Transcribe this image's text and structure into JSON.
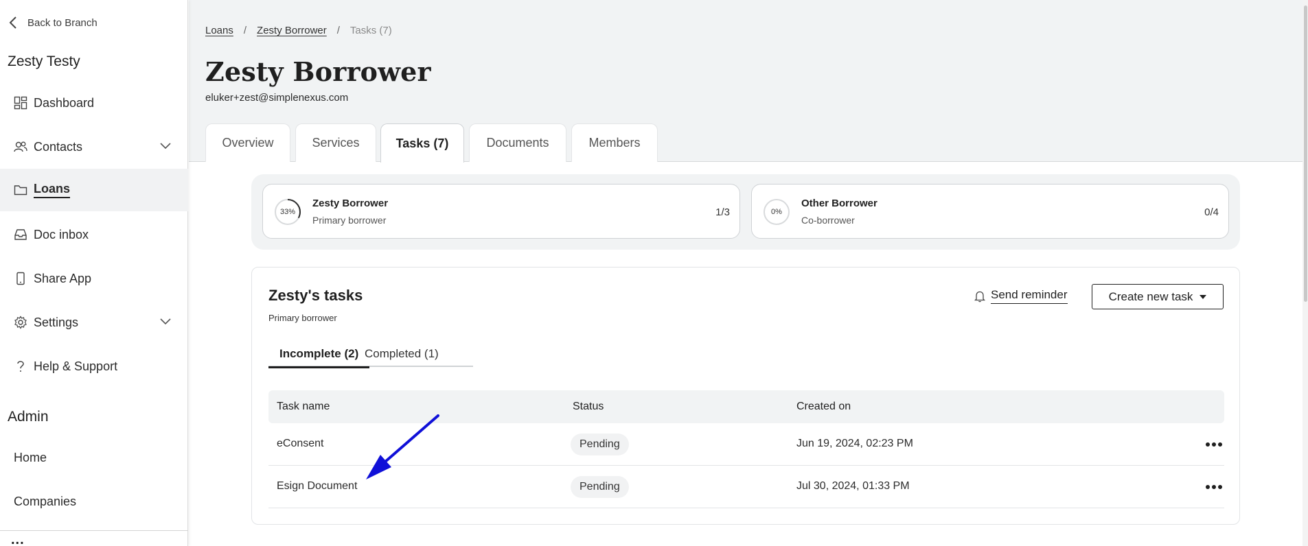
{
  "sidebar": {
    "back_label": "Back to Branch",
    "branch_name": "Zesty Testy",
    "items": [
      {
        "label": "Dashboard",
        "icon": "dashboard-icon"
      },
      {
        "label": "Contacts",
        "icon": "contacts-icon"
      },
      {
        "label": "Loans",
        "icon": "folder-icon",
        "active": true
      },
      {
        "label": "Doc inbox",
        "icon": "inbox-icon"
      },
      {
        "label": "Share App",
        "icon": "phone-icon"
      },
      {
        "label": "Settings",
        "icon": "gear-icon"
      },
      {
        "label": "Help & Support",
        "icon": "question-icon"
      }
    ],
    "admin_heading": "Admin",
    "admin_items": [
      {
        "label": "Home"
      },
      {
        "label": "Companies"
      }
    ],
    "more_label": "..."
  },
  "header": {
    "breadcrumbs": [
      "Loans",
      "Zesty Borrower",
      "Tasks (7)"
    ],
    "title": "Zesty Borrower",
    "email": "eluker+zest@simplenexus.com",
    "tabs": [
      {
        "label": "Overview"
      },
      {
        "label": "Services"
      },
      {
        "label": "Tasks (7)",
        "active": true
      },
      {
        "label": "Documents"
      },
      {
        "label": "Members"
      }
    ]
  },
  "borrowers": [
    {
      "name": "Zesty Borrower",
      "role": "Primary borrower",
      "progress_label": "33%",
      "progress": 0.33,
      "count": "1/3"
    },
    {
      "name": "Other Borrower",
      "role": "Co-borrower",
      "progress_label": "0%",
      "progress": 0,
      "count": "0/4"
    }
  ],
  "tasks": {
    "title": "Zesty's tasks",
    "subtitle": "Primary borrower",
    "send_reminder_label": "Send reminder",
    "create_task_label": "Create new task",
    "subtabs": [
      {
        "label": "Incomplete (2)",
        "active": true
      },
      {
        "label": "Completed (1)"
      }
    ],
    "columns": [
      "Task name",
      "Status",
      "Created on"
    ],
    "rows": [
      {
        "name": "eConsent",
        "status": "Pending",
        "created": "Jun 19, 2024, 02:23 PM"
      },
      {
        "name": "Esign Document",
        "status": "Pending",
        "created": "Jul 30, 2024, 01:33 PM"
      }
    ]
  },
  "colors": {
    "accent_text": "#1f1f1f",
    "panel_bg": "#f1f3f4",
    "annotation_arrow": "#1010d8"
  }
}
